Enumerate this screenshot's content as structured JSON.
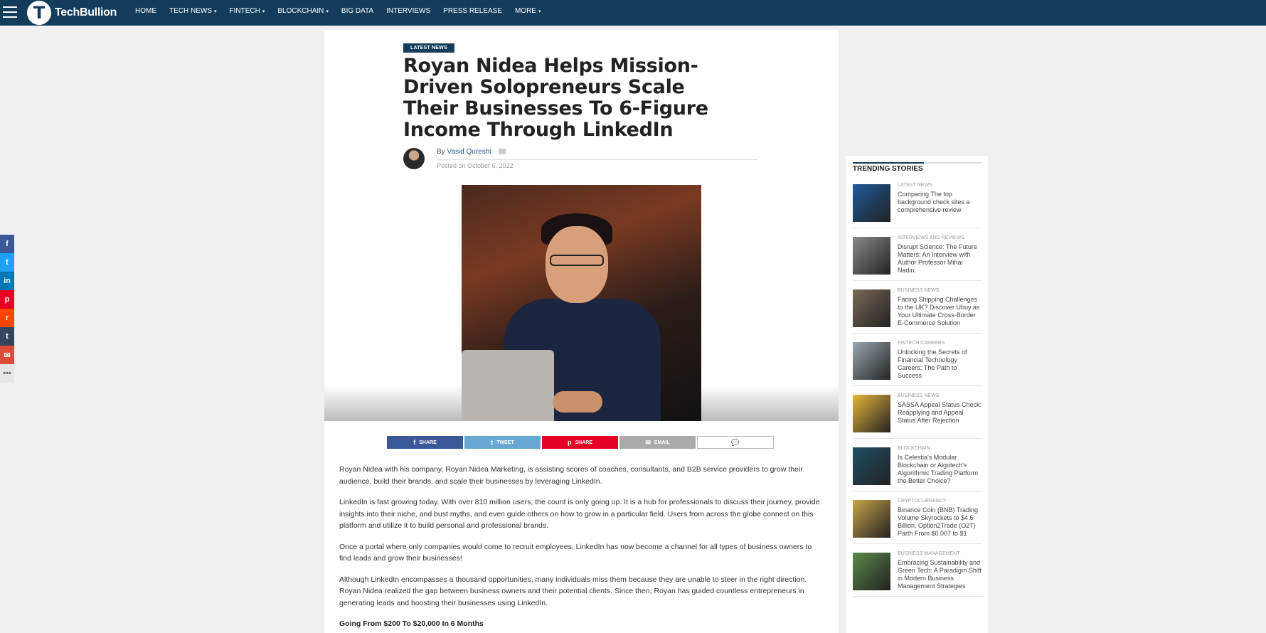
{
  "brand": {
    "name": "TechBullion",
    "logo_letter": "T"
  },
  "nav": {
    "items": [
      {
        "label": "HOME",
        "has_dropdown": false
      },
      {
        "label": "TECH NEWS",
        "has_dropdown": true
      },
      {
        "label": "FINTECH",
        "has_dropdown": true
      },
      {
        "label": "BLOCKCHAIN",
        "has_dropdown": true
      },
      {
        "label": "BIG DATA",
        "has_dropdown": false
      },
      {
        "label": "INTERVIEWS",
        "has_dropdown": false
      },
      {
        "label": "PRESS RELEASE",
        "has_dropdown": false
      },
      {
        "label": "MORE",
        "has_dropdown": true
      }
    ]
  },
  "side_social": [
    {
      "icon": "facebook-icon",
      "glyph": "f",
      "color": "#3b5998"
    },
    {
      "icon": "twitter-icon",
      "glyph": "t",
      "color": "#1da1f2"
    },
    {
      "icon": "linkedin-icon",
      "glyph": "in",
      "color": "#0077b5"
    },
    {
      "icon": "pinterest-icon",
      "glyph": "p",
      "color": "#e60023"
    },
    {
      "icon": "reddit-icon",
      "glyph": "r",
      "color": "#ff4500"
    },
    {
      "icon": "tumblr-icon",
      "glyph": "t",
      "color": "#35465c"
    },
    {
      "icon": "email-icon",
      "glyph": "✉",
      "color": "#dd4b39"
    },
    {
      "icon": "more-icon",
      "glyph": "•••",
      "color": "#e6e6e6"
    }
  ],
  "article": {
    "category_badge": "LATEST NEWS",
    "title": "Royan Nidea Helps Mission-Driven Solopreneurs Scale Their Businesses To 6-Figure Income Through LinkedIn",
    "by_prefix": "By",
    "author": "Vasid Qureshi",
    "posted": "Posted on October 6, 2022",
    "share_buttons": [
      {
        "label": "SHARE",
        "icon": "facebook-icon",
        "glyph": "f",
        "color": "#3b5998"
      },
      {
        "label": "TWEET",
        "icon": "twitter-icon",
        "glyph": "t",
        "color": "#68a7d4"
      },
      {
        "label": "SHARE",
        "icon": "pinterest-icon",
        "glyph": "p",
        "color": "#e60023"
      },
      {
        "label": "EMAIL",
        "icon": "email-icon",
        "glyph": "✉",
        "color": "#aaaaaa"
      }
    ],
    "comment_glyph": "💬",
    "paragraphs": [
      "Royan Nidea with his company, Royan Nidea Marketing, is assisting scores of coaches, consultants, and B2B service providers to grow their audience, build their brands, and scale their businesses by leveraging LinkedIn.",
      "LinkedIn is fast growing today. With over 810 million users, the count is only going up. It is a hub for professionals to discuss their journey, provide insights into their niche, and bust myths, and even guide others on how to grow in a particular field. Users from across the globe connect on this platform and utilize it to build personal and professional brands.",
      "Once a portal where only companies would come to recruit employees, LinkedIn has now become a channel for all types of business owners to find leads and grow their businesses!",
      "Although LinkedIn encompasses a thousand opportunities, many individuals miss them because they are unable to steer in the right direction. Royan Nidea realized the gap between business owners and their potential clients. Since then, Royan has guided countless entrepreneurs in generating leads and boosting their businesses using LinkedIn."
    ],
    "subheading": "Going From $200 To $20,000 In 6 Months"
  },
  "sidebar": {
    "title": "TRENDING STORIES",
    "stories": [
      {
        "category": "LATEST NEWS",
        "title": "Comparing The top background check sites a comprehensive review",
        "thumb": "#1f5a9a"
      },
      {
        "category": "INTERVIEWS AND REVIEWS",
        "title": "Disrupt Science: The Future Matters: An Interview with Author Professor Mihai Nadin.",
        "thumb": "#8a8a8a"
      },
      {
        "category": "BUSINESS NEWS",
        "title": "Facing Shipping Challenges to the UK? Discover Ubuy as Your Ultimate Cross-Border E-Commerce Solution",
        "thumb": "#7a6a55"
      },
      {
        "category": "FINTECH CAREERS",
        "title": "Unlocking the Secrets of Financial Technology Careers: The Path to Success",
        "thumb": "#9aa8b0"
      },
      {
        "category": "BUSINESS NEWS",
        "title": "SASSA Appeal Status Check: Reapplying and Appeal Status After Rejection",
        "thumb": "#e9b53a"
      },
      {
        "category": "BLOCKCHAIN",
        "title": "Is Celestia's Modular Blockchain or Algotech's Algorithmic Trading Platform the Better Choice?",
        "thumb": "#1f4f66"
      },
      {
        "category": "CRYPTOCURRENCY",
        "title": "Binance Coin (BNB) Trading Volume Skyrockets to $4.6 Billion, Option2Trade (O2T) Parth From $0.007 to $1",
        "thumb": "#c9a54a"
      },
      {
        "category": "BUSINESS MANAGEMENT",
        "title": "Embracing Sustainability and Green Tech: A Paradigm Shift in Modern Business Management Strategies",
        "thumb": "#5a8a4a"
      }
    ]
  }
}
